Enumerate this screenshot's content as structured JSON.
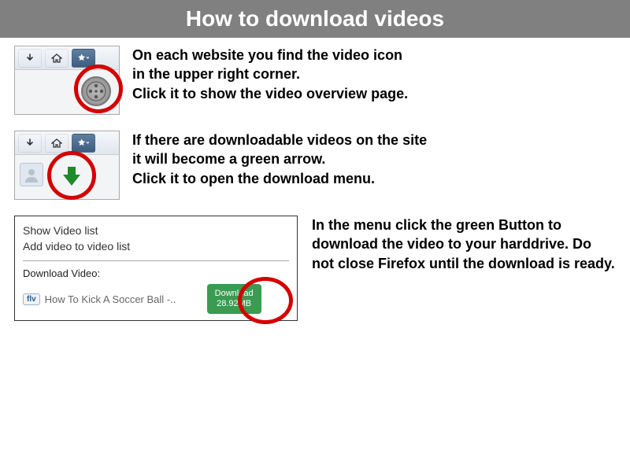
{
  "title": "How to download videos",
  "step1": {
    "desc": "On each website you find the video icon\nin the upper right corner.\nClick it to show the video overview page."
  },
  "step2": {
    "desc": "If there are downloadable videos on the site\nit will become a green arrow.\nClick it to open the download menu."
  },
  "step3": {
    "menu_item_show": "Show Video list",
    "menu_item_add": "Add video to video list",
    "menu_section_label": "Download Video:",
    "flv_badge": "flv",
    "video_title": "How To Kick A Soccer Ball -..",
    "download_label": "Download",
    "download_size": "28.92MB",
    "desc": "In the menu click the green Button to download the video to your harddrive. Do not close Firefox until the download is ready."
  }
}
